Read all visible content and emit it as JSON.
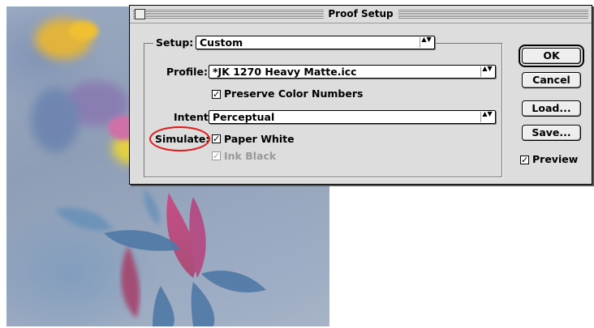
{
  "dialog": {
    "title": "Proof Setup",
    "setup_label": "Setup:",
    "setup_value": "Custom",
    "profile_label": "Profile:",
    "profile_value": "*JK 1270 Heavy Matte.icc",
    "preserve_label": "Preserve Color Numbers",
    "preserve_checked": true,
    "intent_label": "Intent:",
    "intent_value": "Perceptual",
    "simulate_label": "Simulate:",
    "paper_white_label": "Paper White",
    "paper_white_checked": true,
    "ink_black_label": "Ink Black",
    "ink_black_checked": true,
    "ink_black_disabled": true,
    "preview_label": "Preview",
    "preview_checked": true,
    "buttons": {
      "ok": "OK",
      "cancel": "Cancel",
      "load": "Load...",
      "save": "Save..."
    },
    "check_glyph": "✓",
    "popup_arrows_glyph": "▲▼"
  },
  "annotation": {
    "color": "#e01818",
    "target": "simulate-label"
  },
  "photo": {
    "subject": "flower-photo"
  }
}
